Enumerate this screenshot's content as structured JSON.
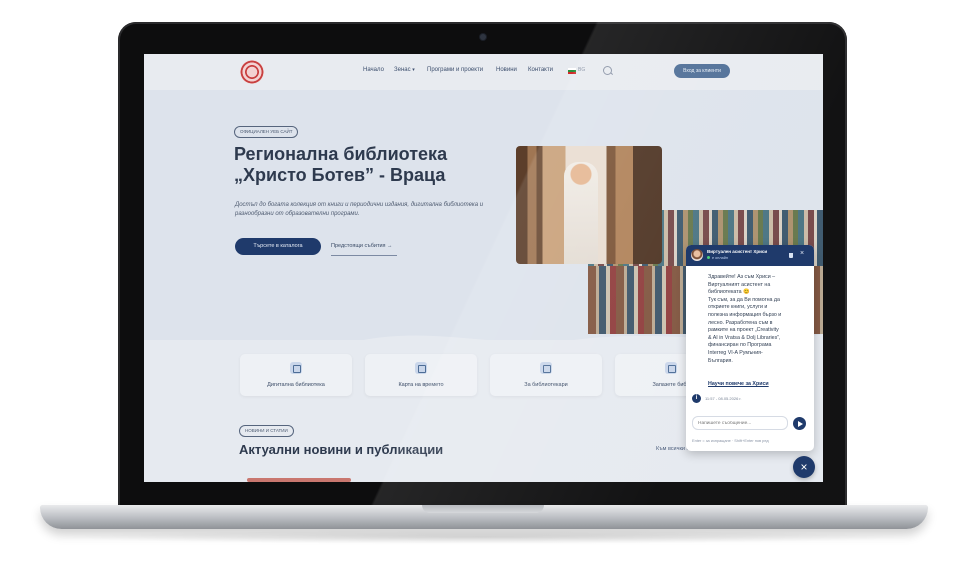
{
  "header": {
    "nav": [
      {
        "label": "Начало",
        "caret": false
      },
      {
        "label": "Зенас",
        "caret": true
      },
      {
        "label": "Програми и проекти",
        "caret": false
      },
      {
        "label": "Новини",
        "caret": false
      },
      {
        "label": "Контакти",
        "caret": false
      }
    ],
    "lang": "BG",
    "login_label": "Вход за клиенти"
  },
  "hero": {
    "badge": "ОФИЦИАЛЕН УЕБ САЙТ",
    "title_line1": "Регионална библиотека",
    "title_line2": "„Христо Ботев” - Враца",
    "description": "Достъп до богата колекция от книги и периодични издания, дигитална библиотека и разнообразни от образователни програми.",
    "primary_button": "Търсете в каталога",
    "secondary_link": "Предстоящи събития",
    "secondary_arrow": "→"
  },
  "features": [
    {
      "label": "Дигитална библиотека",
      "icon": "book-icon"
    },
    {
      "label": "Карта на времето",
      "icon": "history-icon"
    },
    {
      "label": "За библиотекари",
      "icon": "calendar-icon"
    },
    {
      "label": "Запазете библ",
      "icon": "monitor-icon"
    }
  ],
  "news": {
    "badge": "НОВИНИ И СТАТИИ",
    "title": "Актуални новини и публикации",
    "all_link": "Към всички новини"
  },
  "chat": {
    "title": "Виртуален асистент Хриси",
    "status": "е онлайн",
    "close": "×",
    "message": [
      "Здравейте! Аз съм Хриси –",
      "Виртуалният асистент на",
      "библиотеката 😊",
      "Тук съм, за да Ви помогна да",
      "откриете книги, услуги и",
      "полезна информация бързо и",
      "лесно. Разработена съм в",
      "рамките на проект „Creativity",
      "& AI in Vratsa & Dolj Libraries”,",
      "финансиран по Програма",
      "Interreg VI-A Румъния-",
      "България."
    ],
    "link": "Научи повече за Хриси",
    "info": "i",
    "time": "11:57 - 08.05.2026 г.",
    "input_placeholder": "Напишете съобщение...",
    "hint": "Enter = за изпращане · Shift+Enter нов ред"
  },
  "fab_label": "×",
  "colors": {
    "primary": "#1f3a6b",
    "accent_red": "#c84040",
    "text_dark": "#2e3a4e"
  }
}
